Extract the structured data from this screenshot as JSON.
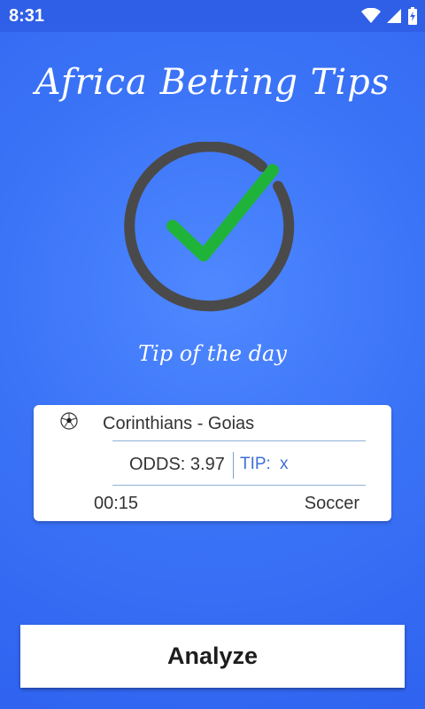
{
  "status_bar": {
    "time": "8:31",
    "icons": [
      "wifi-icon",
      "cell-signal-icon",
      "battery-icon"
    ]
  },
  "app": {
    "title": "Africa Betting Tips",
    "subtitle": "Tip of the day",
    "hero_icon": "check-circle-icon"
  },
  "tip_card": {
    "sport_icon": "soccer-ball-icon",
    "match": "Corinthians - Goias",
    "odds": "ODDS: 3.97",
    "tip_label": "TIP:",
    "tip_value": "x",
    "time": "00:15",
    "sport": "Soccer"
  },
  "actions": {
    "analyze_label": "Analyze"
  },
  "colors": {
    "background": "#3b74f7",
    "status_bar": "#2f5fe6",
    "check_green": "#1fb33a",
    "ring_gray": "#4a4a4a",
    "tip_blue": "#3f6fd6"
  }
}
